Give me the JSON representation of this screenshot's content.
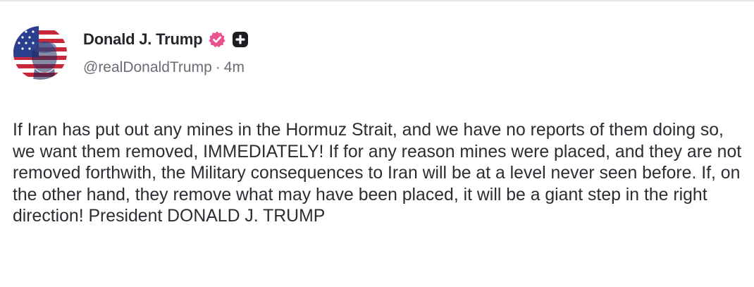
{
  "post": {
    "author": {
      "display_name": "Donald J. Trump",
      "handle": "@realDonaldTrump",
      "verified_badge_icon": "verified-badge-icon",
      "plus_badge_icon": "plus-badge-icon"
    },
    "separator": "·",
    "timestamp": "4m",
    "text": "If Iran has put out any mines in the Hormuz Strait, and we have no reports of them doing so, we want them removed, IMMEDIATELY! If for any reason mines were placed, and they are not removed forthwith, the Military consequences to Iran will be at a level never seen before. If, on the other hand, they remove what may have been placed, it will be a giant step in the right direction! President DONALD J. TRUMP"
  },
  "colors": {
    "verified_badge": "#e8538f",
    "text": "#2c2c33",
    "secondary_text": "#6b6b75"
  }
}
